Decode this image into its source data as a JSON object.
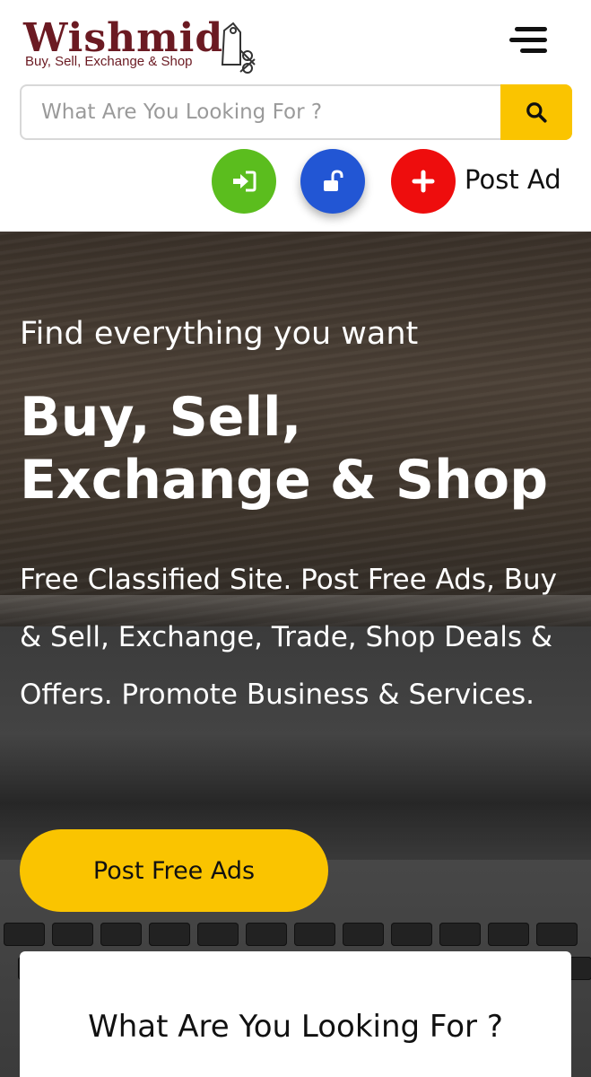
{
  "header": {
    "logo": {
      "name": "Wishmid",
      "tagline": "Buy, Sell, Exchange & Shop"
    },
    "menu_icon": "hamburger-menu-icon",
    "search": {
      "placeholder": "What Are You Looking For ?",
      "button_icon": "search-icon"
    },
    "actions": {
      "login_icon": "sign-in-icon",
      "register_icon": "unlock-icon",
      "post_icon": "plus-icon",
      "post_label": "Post Ad"
    }
  },
  "hero": {
    "kicker": "Find everything you want",
    "title": "Buy, Sell, Exchange & Shop",
    "description": "Free Classified Site. Post Free Ads, Buy & Sell, Exchange, Trade, Shop Deals & Offers. Promote Business & Services.",
    "cta_label": "Post Free Ads"
  },
  "search_card": {
    "title": "What Are You Looking For ?"
  },
  "colors": {
    "accent_yellow": "#fac400",
    "login_green": "#5bbd1e",
    "register_blue": "#2256d4",
    "post_red": "#ee0d0d",
    "logo_maroon": "#6b1a22"
  }
}
